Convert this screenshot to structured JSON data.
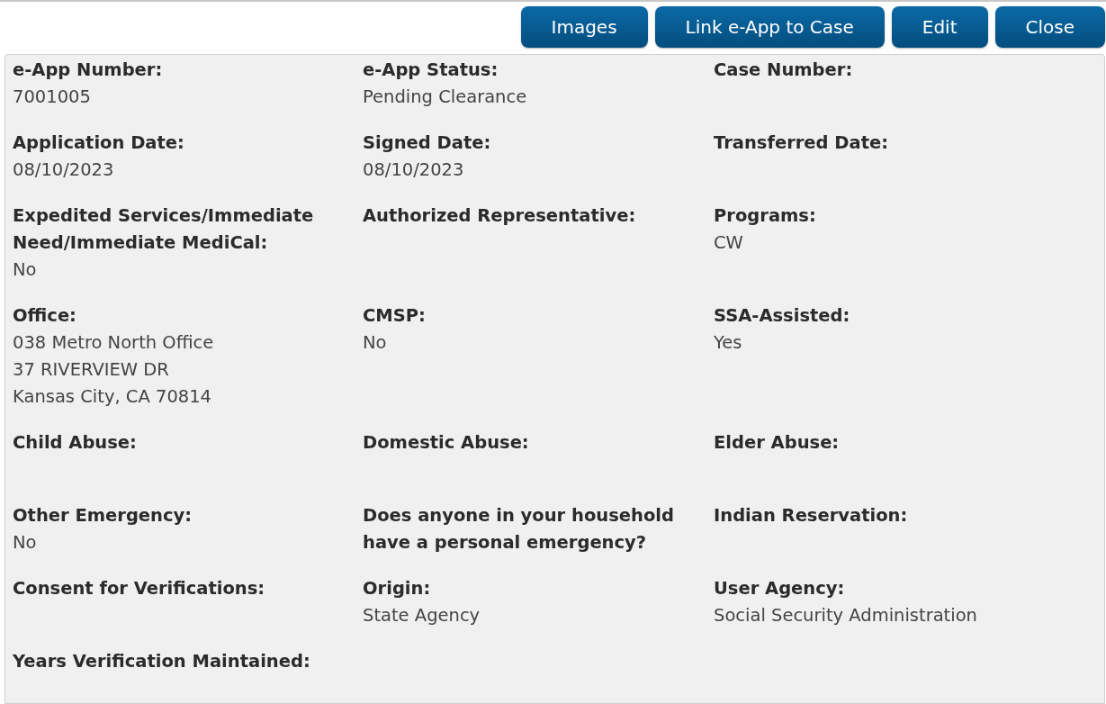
{
  "toolbar": {
    "buttons": [
      "Images",
      "Link e-App to Case",
      "Edit",
      "Close"
    ]
  },
  "fields": [
    {
      "label": "e-App Number:",
      "value": [
        "7001005"
      ]
    },
    {
      "label": "e-App Status:",
      "value": [
        "Pending Clearance"
      ]
    },
    {
      "label": "Case Number:"
    },
    {
      "label": "Application Date:",
      "value": [
        "08/10/2023"
      ]
    },
    {
      "label": "Signed Date:",
      "value": [
        "08/10/2023"
      ]
    },
    {
      "label": "Transferred Date:"
    },
    {
      "label": "Expedited Services/Immediate Need/Immediate MediCal:",
      "value": [
        "No"
      ]
    },
    {
      "label": "Authorized Representative:"
    },
    {
      "label": "Programs:",
      "value": [
        "CW"
      ]
    },
    {
      "label": "Office:",
      "value": [
        "038 Metro North Office",
        "37 RIVERVIEW DR",
        "Kansas City, CA 70814"
      ]
    },
    {
      "label": "CMSP:",
      "value": [
        "No"
      ]
    },
    {
      "label": "SSA-Assisted:",
      "value": [
        "Yes"
      ]
    },
    {
      "label": "Child Abuse:"
    },
    {
      "label": "Domestic Abuse:"
    },
    {
      "label": "Elder Abuse:"
    },
    {
      "label": "Other Emergency:",
      "value": [
        "No"
      ]
    },
    {
      "label": "Does anyone in your household have a personal emergency?"
    },
    {
      "label": "Indian Reservation:"
    },
    {
      "label": "Consent for Verifications:"
    },
    {
      "label": "Origin:",
      "value": [
        "State Agency"
      ]
    },
    {
      "label": "User Agency:",
      "value": [
        "Social Security Administration"
      ]
    },
    {
      "label": "Years Verification Maintained:"
    }
  ]
}
